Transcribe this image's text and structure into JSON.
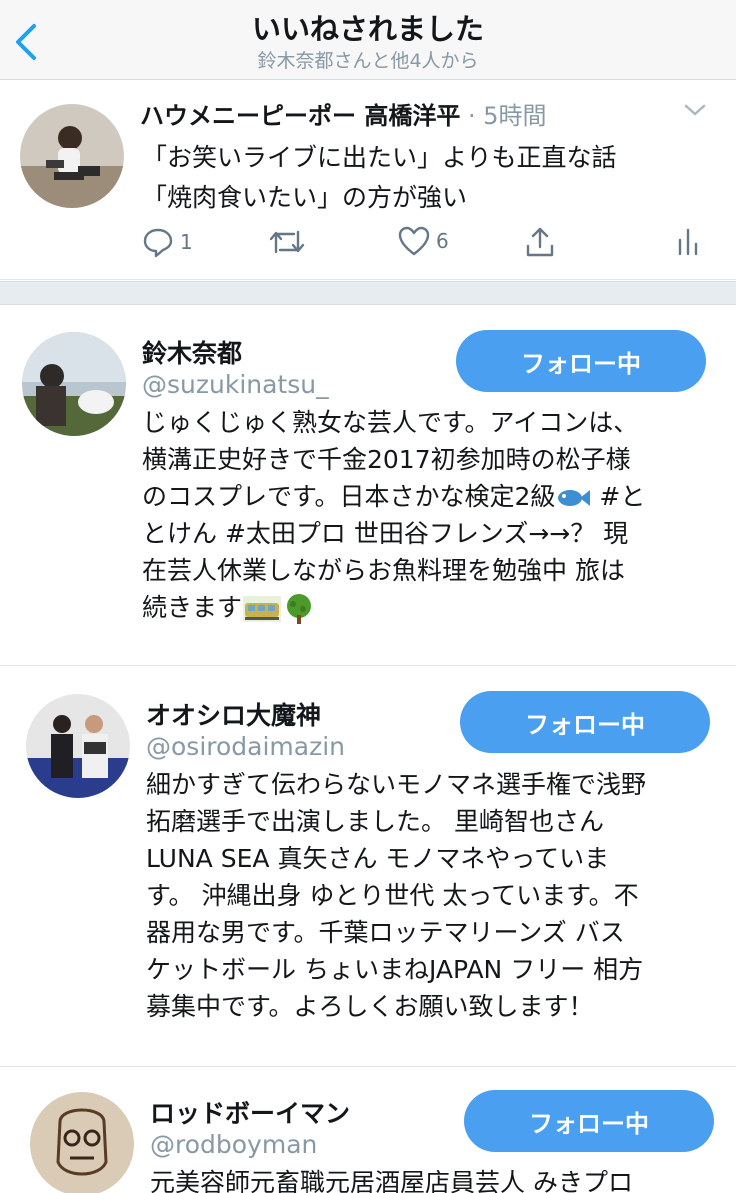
{
  "header": {
    "title": "いいねされました",
    "subtitle": "鈴木奈都さんと他4人から"
  },
  "tweet": {
    "author": "ハウメニーピーポー 高橋洋平",
    "time": "· 5時間",
    "lines": [
      "「お笑いライブに出たい」よりも正直な話",
      "「焼肉食いたい」の方が強い"
    ],
    "reply_count": "1",
    "like_count": "6"
  },
  "users": [
    {
      "name": "鈴木奈都",
      "handle": "@suzukinatsu_",
      "button": "フォロー中",
      "bio": [
        "じゅくじゅく熟女な芸人です。アイコンは、",
        "横溝正史好きで千金2017初参加時の松子様",
        "のコスプレです。日本さかな検定2級",
        " #と",
        "とけん #太田プロ 世田谷フレンズ→→？ 現",
        "在芸人休業しながらお魚料理を勉強中 旅は",
        "続きます"
      ]
    },
    {
      "name": "オオシロ大魔神",
      "handle": "@osirodaimazin",
      "button": "フォロー中",
      "bio": [
        "細かすぎて伝わらないモノマネ選手権で浅野",
        "拓磨選手で出演しました。 里崎智也さん",
        "LUNA SEA 真矢さん モノマネやっていま",
        "す。 沖縄出身 ゆとり世代 太っています。不",
        "器用な男です。千葉ロッテマリーンズ バス",
        "ケットボール ちょいまねJAPAN フリー 相方",
        "募集中です。よろしくお願い致します！"
      ]
    },
    {
      "name": "ロッドボーイマン",
      "handle": "@rodboyman",
      "button": "フォロー中",
      "bio": [
        "元美容師元畜職元居酒屋店員芸人 みきプロ"
      ]
    }
  ],
  "icons": [
    "back-chevron-icon",
    "caret-down-icon",
    "reply-icon",
    "retweet-icon",
    "like-icon",
    "share-icon",
    "analytics-icon",
    "fish-emoji-icon",
    "train-emoji-icon",
    "tree-emoji-icon"
  ],
  "colors": {
    "accent": "#4a9ff0",
    "muted": "#8899a6",
    "divider": "#e1e8ed"
  }
}
